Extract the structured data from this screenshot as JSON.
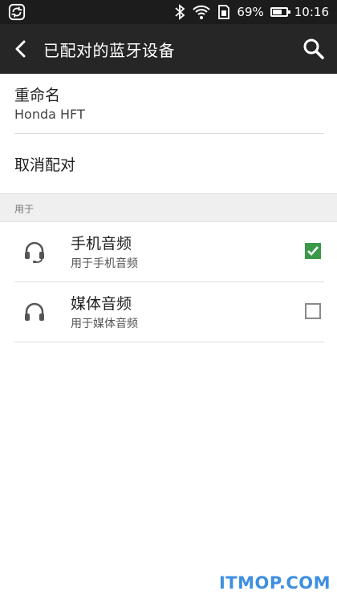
{
  "status_bar": {
    "battery_percent": "69%",
    "time": "10:16",
    "icons": [
      "sync-icon",
      "bluetooth-icon",
      "wifi-icon",
      "sim-icon",
      "battery-icon"
    ],
    "battery_level": 0.69
  },
  "toolbar": {
    "title": "已配对的蓝牙设备",
    "back_icon": "back-arrow-icon",
    "search_icon": "search-icon"
  },
  "rename": {
    "title": "重命名",
    "value": "Honda HFT"
  },
  "unpair": {
    "title": "取消配对"
  },
  "section": {
    "header": "用于"
  },
  "profiles": [
    {
      "title": "手机音频",
      "subtitle": "用于手机音频",
      "icon": "headset-icon",
      "checked": true
    },
    {
      "title": "媒体音频",
      "subtitle": "用于媒体音频",
      "icon": "headphones-icon",
      "checked": false
    }
  ],
  "watermark": "ITMOP.COM",
  "colors": {
    "toolbar_bg": "#262626",
    "status_bg": "#1c1c1c",
    "check_green": "#3a9a4a",
    "watermark_blue": "#3f8fe0"
  }
}
